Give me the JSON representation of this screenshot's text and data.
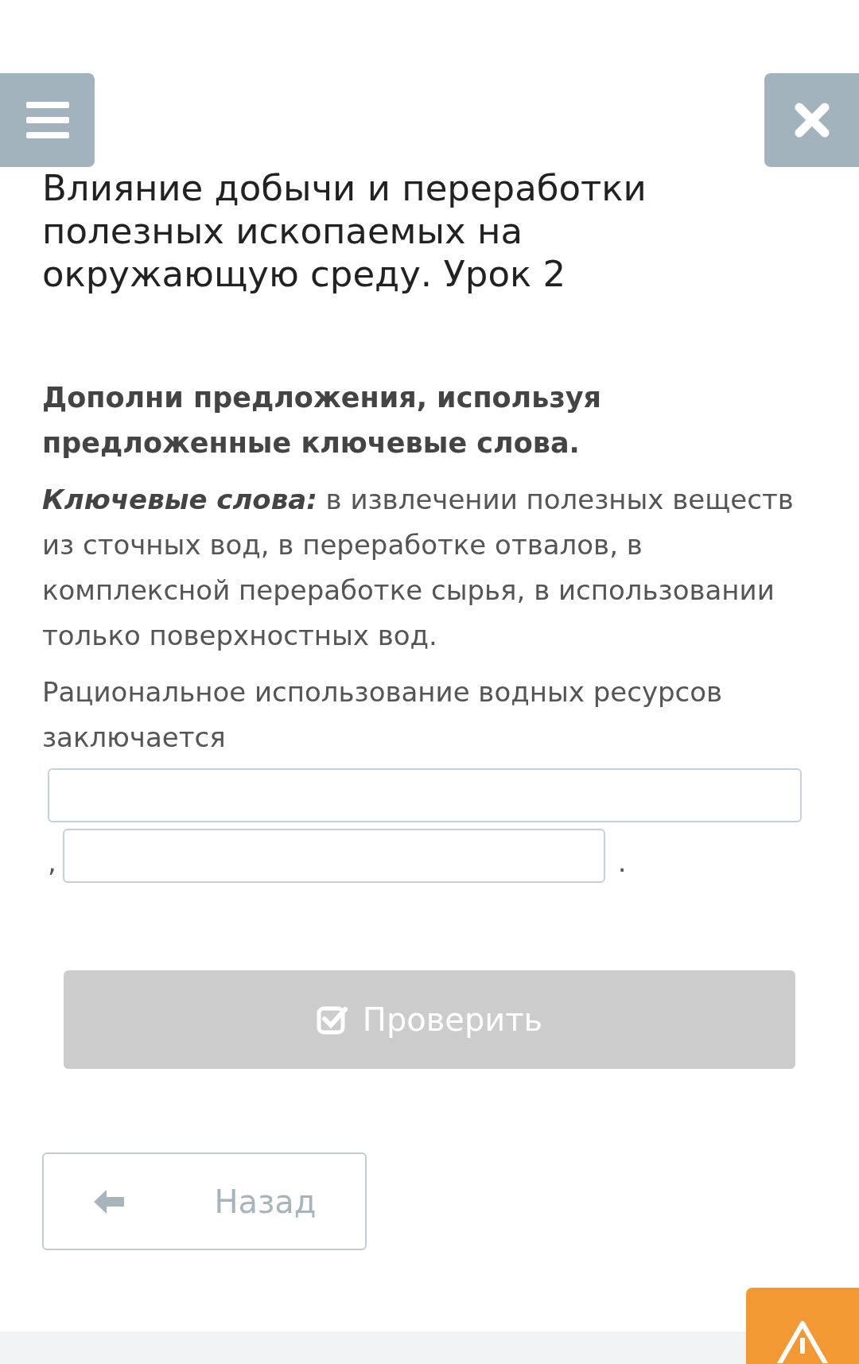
{
  "title": "Влияние добычи и переработки полезных ископаемых на окружающую среду. Урок 2",
  "instruction": "Дополни предложения, используя предложенные ключевые слова.",
  "keywords": {
    "label": "Ключевые слова:",
    "text": "в извлечении полезных веществ из сточных вод, в переработке отвалов, в комплексной переработке сырья, в использовании только поверхностных вод."
  },
  "sentence": "Рациональное использование водных ресурсов заключается",
  "answer": {
    "fields": [
      {
        "kind": "wide"
      },
      {
        "kind": "short"
      }
    ],
    "separator": ",",
    "end": "."
  },
  "check_button": {
    "label": "Проверить",
    "disabled": true
  },
  "back_button": {
    "label": "Назад"
  }
}
